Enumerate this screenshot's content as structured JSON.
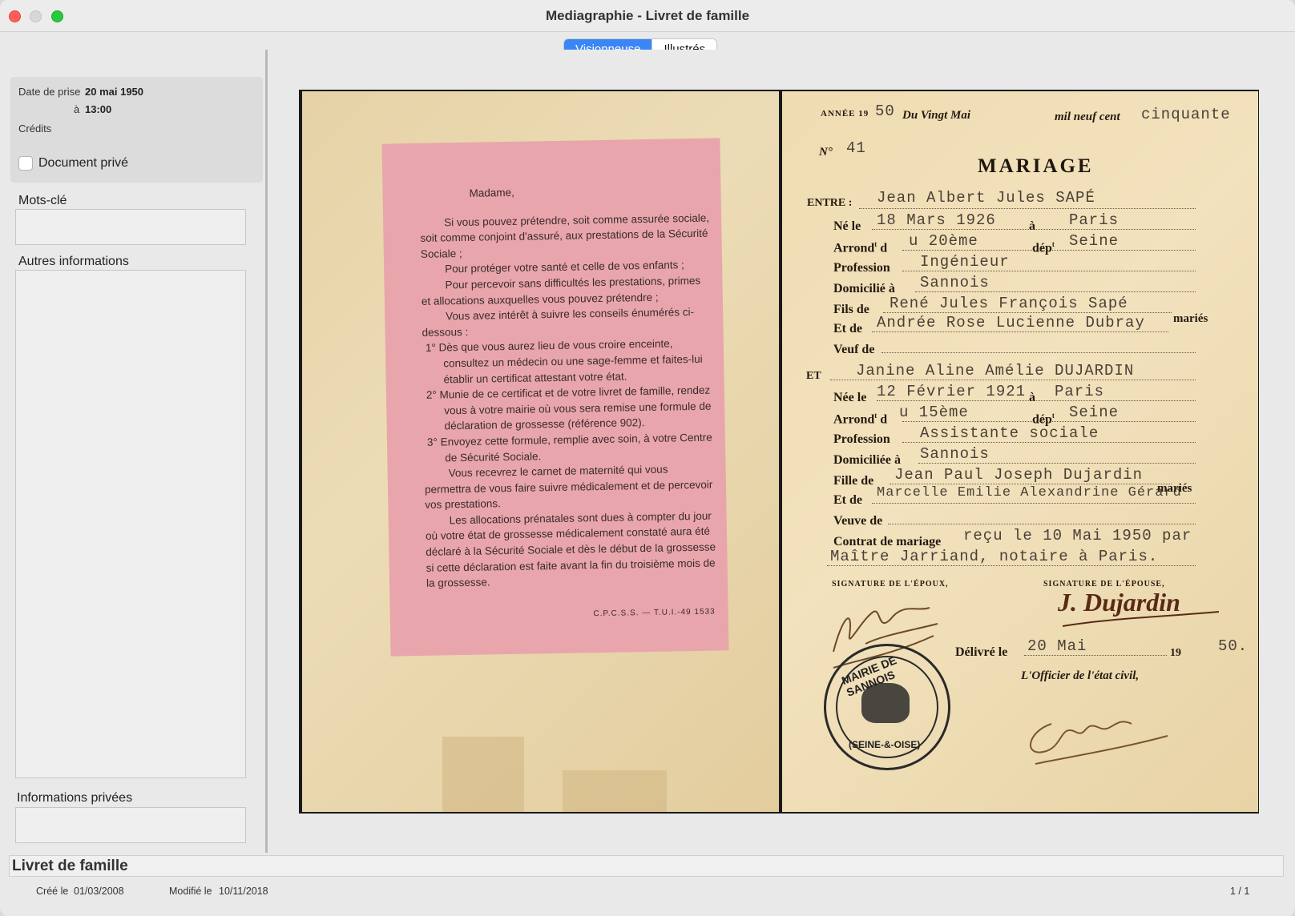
{
  "window": {
    "title": "Mediagraphie  - Livret de famille"
  },
  "tabs": [
    {
      "label": "Visionneuse",
      "active": true
    },
    {
      "label": "Illustrés",
      "active": false
    }
  ],
  "sidebar": {
    "date_label": "Date de prise",
    "date_value": "20 mai 1950",
    "time_label": "à",
    "time_value": "13:00",
    "credits_label": "Crédits",
    "private_checkbox_label": "Document privé",
    "private_checked": false,
    "keywords_label": "Mots-clé",
    "other_info_label": "Autres informations",
    "private_info_label": "Informations privées"
  },
  "document": {
    "pink_slip": {
      "salutation": "Madame,",
      "paragraphs": [
        "Si vous pouvez prétendre, soit comme assurée sociale, soit comme conjoint d'assuré, aux prestations de la Sécurité Sociale ;",
        "Pour protéger votre santé et celle de vos enfants ;",
        "Pour percevoir sans difficultés les prestations, primes et allocations auxquelles vous pouvez prétendre ;",
        "Vous avez intérêt à suivre les conseils énumérés ci-dessous :"
      ],
      "numbered": [
        "1° Dès que vous aurez lieu de vous croire enceinte, consultez un médecin ou une sage-femme et faites-lui établir un certificat attestant votre état.",
        "2° Munie de ce certificat et de votre livret de famille, rendez vous à votre mairie où vous sera remise une formule de déclaration de grossesse (référence 902).",
        "3° Envoyez cette formule, remplie avec soin, à votre Centre de Sécurité Sociale."
      ],
      "closing": [
        "Vous recevrez le carnet de maternité qui vous permettra de vous faire suivre médicalement et de percevoir vos prestations.",
        "Les allocations prénatales sont dues à compter du jour où votre état de grossesse médicalement constaté aura été déclaré à la Sécurité Sociale et dès le début de la grossesse si cette déclaration est faite avant la fin du troisième mois de la grossesse."
      ],
      "footer": "C.P.C.S.S. — T.U.I.-49   1533"
    },
    "certificate": {
      "annee_label": "ANNÉE 19",
      "annee_value": "50",
      "date_typed": "Du Vingt Mai",
      "mil_label": "mil neuf cent",
      "year_typed": "cinquante",
      "no_label": "N°",
      "no_value": "41",
      "heading": "MARIAGE",
      "entre_label": "ENTRE :",
      "groom_name": "Jean Albert Jules SAPÉ",
      "ne_le_label": "Né le",
      "groom_birth": "18 Mars 1926",
      "a_label": "à",
      "groom_city": "Paris",
      "arrond_label": "Arrond",
      "arrond_sup": "t",
      "arrond_d": "d",
      "groom_arrond": "u 20ème",
      "dep_label": "dép",
      "dep_sup": "t",
      "groom_dep": "Seine",
      "profession_label": "Profession",
      "groom_profession": "Ingénieur",
      "domicilie_label": "Domicilié à",
      "groom_domicile": "Sannois",
      "fils_label": "Fils de",
      "groom_father": "René Jules François Sapé",
      "et_de_label": "Et de",
      "groom_mother": "Andrée Rose Lucienne Dubray",
      "maries_label": "mariés",
      "veuf_label": "Veuf de",
      "et_label": "ET",
      "bride_name": "Janine Aline Amélie DUJARDIN",
      "nee_le_label": "Née le",
      "bride_birth": "12 Février 1921",
      "bride_city": "Paris",
      "bride_arrond": "u 15ème",
      "bride_dep": "Seine",
      "bride_profession": "Assistante sociale",
      "domiciliee_label": "Domiciliée à",
      "bride_domicile": "Sannois",
      "fille_label": "Fille de",
      "bride_father": "Jean Paul Joseph Dujardin",
      "bride_mother": "Marcelle Emilie Alexandrine Gérard",
      "veuve_label": "Veuve de",
      "contrat_label": "Contrat de mariage",
      "contrat_line1": "reçu le 10 Mai 1950 par",
      "contrat_line2": "Maître Jarriand, notaire à Paris.",
      "sig_epoux_label": "SIGNATURE DE L'ÉPOUX,",
      "sig_epouse_label": "SIGNATURE DE L'ÉPOUSE,",
      "sig_epouse_value": "J. Dujardin",
      "delivre_label": "Délivré le",
      "delivre_value": "20 Mai",
      "delivre_19": "19",
      "delivre_year": "50.",
      "officier_label": "L'Officier de l'état civil,",
      "stamp_text": "MAIRIE DE SANNOIS",
      "stamp_bottom": "(SEINE-&-OISE)"
    }
  },
  "footer": {
    "record_name": "Livret de famille",
    "created_label": "Créé le",
    "created_value": "01/03/2008",
    "modified_label": "Modifié le",
    "modified_value": "10/11/2018",
    "page_indicator": "1 / 1"
  }
}
